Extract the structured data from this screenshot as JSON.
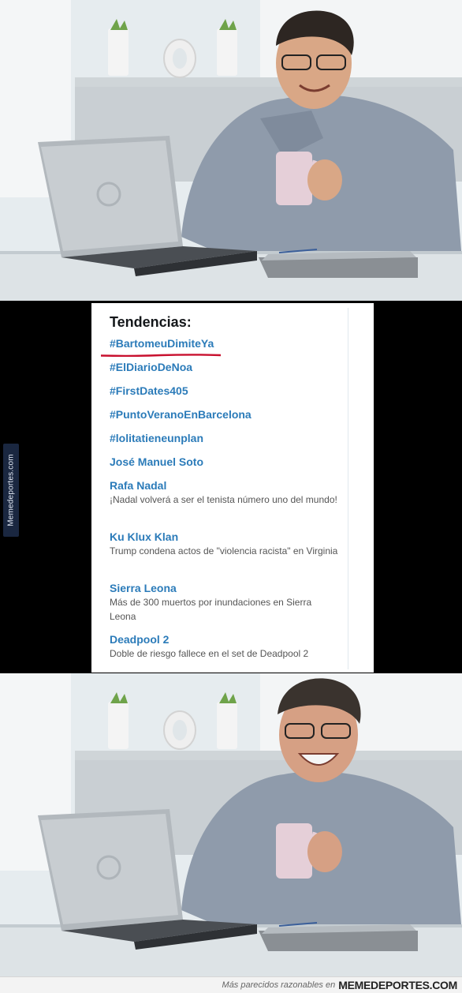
{
  "trends": {
    "title": "Tendencias:",
    "items": [
      {
        "name": "#BartomeuDimiteYa",
        "desc": ""
      },
      {
        "name": "#ElDiarioDeNoa",
        "desc": ""
      },
      {
        "name": "#FirstDates405",
        "desc": ""
      },
      {
        "name": "#PuntoVeranoEnBarcelona",
        "desc": ""
      },
      {
        "name": "#lolitatieneunplan",
        "desc": ""
      },
      {
        "name": "José Manuel Soto",
        "desc": ""
      },
      {
        "name": "Rafa Nadal",
        "desc": "¡Nadal volverá a ser el tenista número uno del mundo!"
      },
      {
        "name": "Ku Klux Klan",
        "desc": "Trump condena actos de \"violencia racista\" en Virginia"
      },
      {
        "name": "Sierra Leona",
        "desc": "Más de 300 muertos por inundaciones en Sierra Leona"
      },
      {
        "name": "Deadpool 2",
        "desc": "Doble de riesgo fallece en el set de Deadpool 2"
      }
    ],
    "highlight_color": "#c8102e",
    "link_color": "#2b7bb9"
  },
  "watermark": {
    "side_text": "Memedeportes.com"
  },
  "footer": {
    "tagline": "Más parecidos razonables en",
    "brand": "MEMEDEPORTES.COM"
  }
}
